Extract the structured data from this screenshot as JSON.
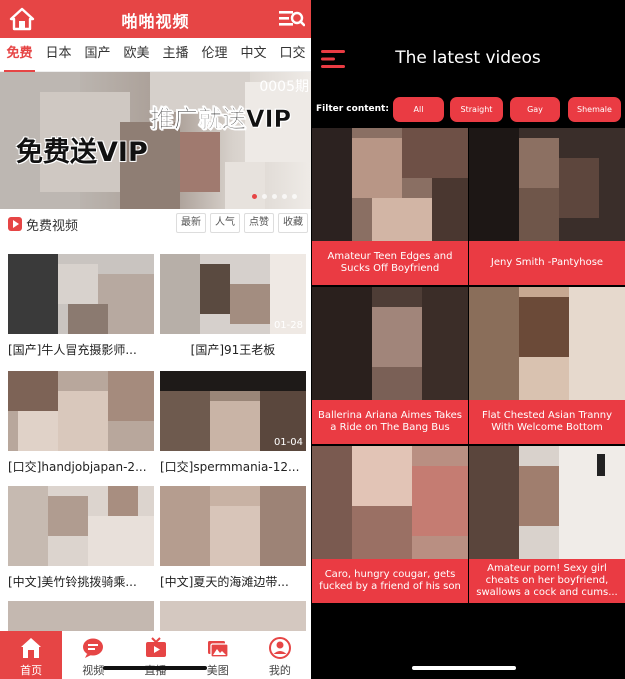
{
  "left_app": {
    "header": {
      "title": "啪啪视频"
    },
    "tabs": [
      "免费",
      "日本",
      "国产",
      "欧美",
      "主播",
      "伦理",
      "中文",
      "口交"
    ],
    "banner": {
      "text_top": "推广就送VIP",
      "text_main": "免费送VIP",
      "issue_label": "0005期"
    },
    "section": {
      "title": "免费视频",
      "sorts": [
        "最新",
        "人气",
        "点赞",
        "收藏"
      ]
    },
    "videos": [
      {
        "caption": "[国产]牛人冒充摄影师...",
        "duration": ""
      },
      {
        "caption": "[国产]91王老板",
        "duration": "01-28"
      },
      {
        "caption": "[口交]handjobjapan-2...",
        "duration": ""
      },
      {
        "caption": "[口交]spermmania-12...",
        "duration": "01-04"
      },
      {
        "caption": "[中文]美竹铃挑拨骑乘...",
        "duration": ""
      },
      {
        "caption": "[中文]夏天的海滩边带...",
        "duration": ""
      }
    ],
    "bottom_nav": [
      {
        "label": "首页",
        "icon": "home-icon"
      },
      {
        "label": "视频",
        "icon": "chat-video-icon"
      },
      {
        "label": "直播",
        "icon": "live-tv-icon"
      },
      {
        "label": "美图",
        "icon": "photos-icon"
      },
      {
        "label": "我的",
        "icon": "user-icon"
      }
    ],
    "colors": {
      "accent": "#e64545"
    }
  },
  "right_app": {
    "header": {
      "title": "The latest videos"
    },
    "filter": {
      "label": "Filter content:",
      "options": [
        "All",
        "Straight",
        "Gay",
        "Shemale"
      ]
    },
    "videos": [
      {
        "title": "Amateur Teen Edges and Sucks Off Boyfriend"
      },
      {
        "title": "Jeny Smith -Pantyhose"
      },
      {
        "title": "Ballerina Ariana Aimes Takes a Ride on The Bang Bus"
      },
      {
        "title": "Flat Chested Asian Tranny With Welcome Bottom"
      },
      {
        "title": "Caro, hungry cougar, gets fucked by a friend of his son"
      },
      {
        "title": "Amateur porn! Sexy girl cheats on her boyfriend, swallows a cock and cums..."
      }
    ],
    "colors": {
      "accent": "#ea3b43",
      "background": "#000000"
    }
  }
}
